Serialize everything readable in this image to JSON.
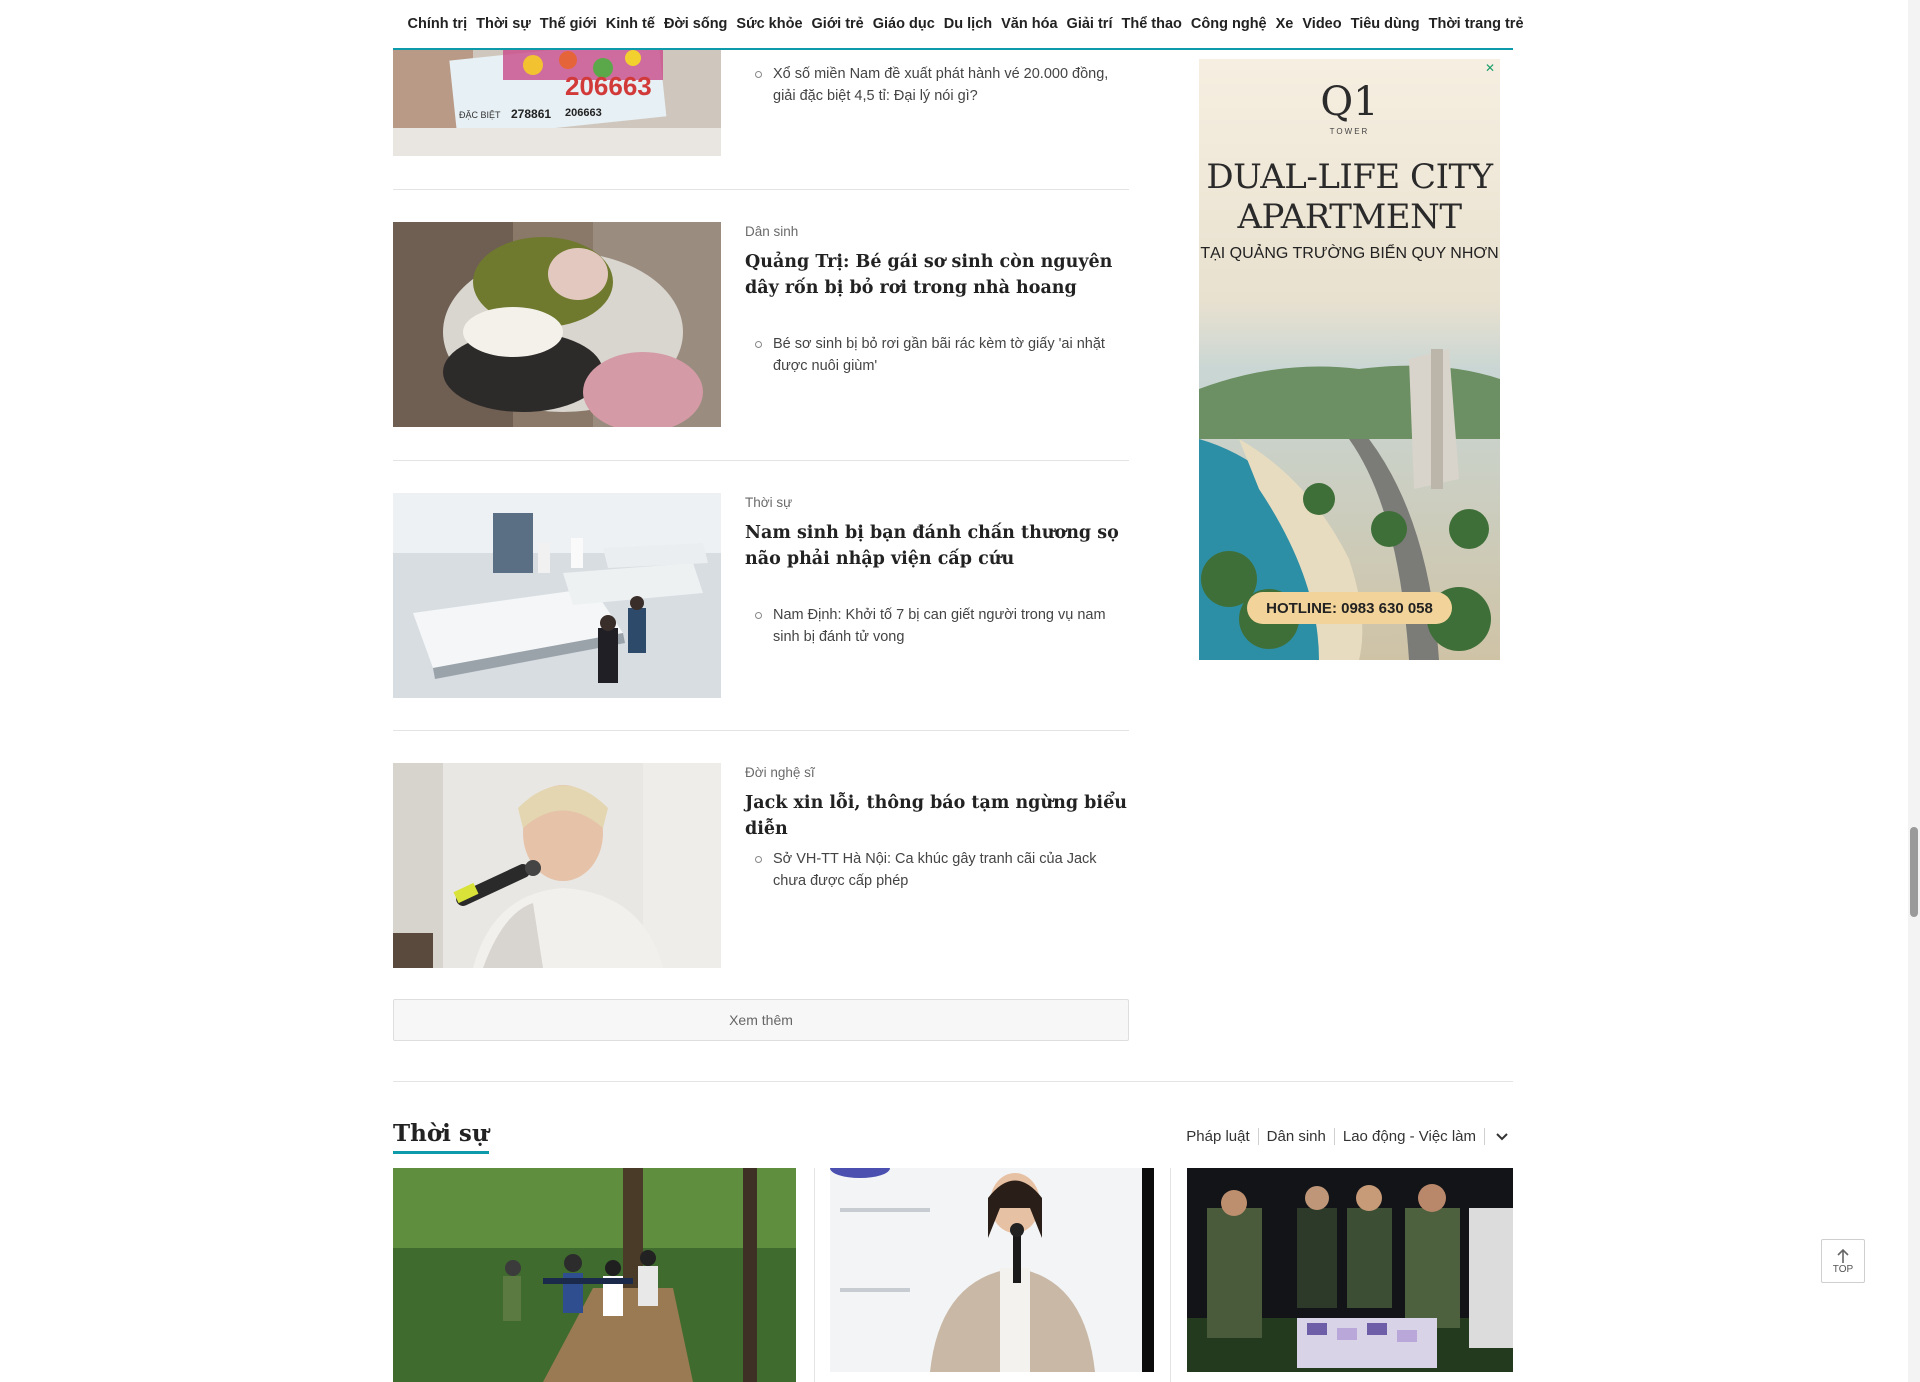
{
  "nav": {
    "items": [
      "Chính trị",
      "Thời sự",
      "Thế giới",
      "Kinh tế",
      "Đời sống",
      "Sức khỏe",
      "Giới trẻ",
      "Giáo dục",
      "Du lịch",
      "Văn hóa",
      "Giải trí",
      "Thể thao",
      "Công nghệ",
      "Xe",
      "Video",
      "Tiêu dùng",
      "Thời trang trẻ"
    ]
  },
  "stories": [
    {
      "related": "Xổ số miền Nam đề xuất phát hành vé 20.000 đồng, giải đặc biệt 4,5 tỉ: Đại lý nói gì?",
      "ticket_text": [
        "206663",
        "278861",
        "206663",
        "ĐẶC BIỆT"
      ]
    },
    {
      "category": "Dân sinh",
      "title": "Quảng Trị: Bé gái sơ sinh còn nguyên dây rốn bị bỏ rơi trong nhà hoang",
      "related": "Bé sơ sinh bị bỏ rơi gần bãi rác kèm tờ giấy 'ai nhặt được nuôi giùm'"
    },
    {
      "category": "Thời sự",
      "title": "Nam sinh bị bạn đánh chấn thương sọ não phải nhập viện cấp cứu",
      "related": "Nam Định: Khởi tố 7 bị can giết người trong vụ nam sinh bị đánh tử vong"
    },
    {
      "category": "Đời nghệ sĩ",
      "title": "Jack xin lỗi, thông báo tạm ngừng biểu diễn",
      "related": "Sở VH-TT Hà Nội: Ca khúc gây tranh cãi của Jack chưa được cấp phép"
    }
  ],
  "more_button": "Xem thêm",
  "section": {
    "title": "Thời sự",
    "links": [
      "Pháp luật",
      "Dân sinh",
      "Lao động - Việc làm"
    ]
  },
  "ad": {
    "logo": "Q1",
    "logo_sub": "TOWER",
    "headline": "DUAL-LIFE CITY APARTMENT",
    "subheadline": "TẠI QUẢNG TRƯỜNG BIỂN QUY NHƠN",
    "hotline": "HOTLINE: 0983 630 058"
  },
  "top_button": "TOP",
  "colors": {
    "accent": "#0d9aaa",
    "ad_badge": "#f2d49a"
  }
}
